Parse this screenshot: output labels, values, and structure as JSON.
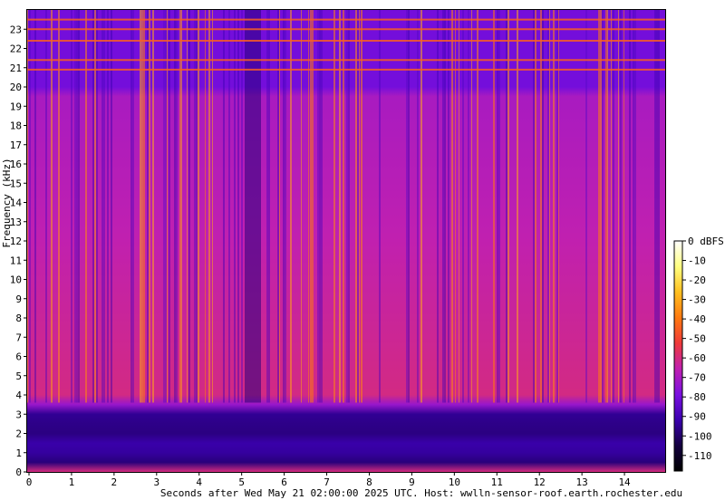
{
  "chart_data": {
    "type": "heatmap",
    "title": "",
    "xlabel": "Seconds after Wed May 21 02:00:00 2025 UTC. Host: wwlln-sensor-roof.earth.rochester.edu",
    "ylabel": "Frequency (kHz)",
    "xlim": [
      0,
      15
    ],
    "ylim": [
      0,
      24
    ],
    "x_ticks": [
      "0",
      "1",
      "2",
      "3",
      "4",
      "5",
      "6",
      "7",
      "8",
      "9",
      "10",
      "11",
      "12",
      "13",
      "14"
    ],
    "y_ticks": [
      "0",
      "1",
      "2",
      "3",
      "4",
      "5",
      "6",
      "7",
      "8",
      "9",
      "10",
      "11",
      "12",
      "13",
      "14",
      "15",
      "16",
      "17",
      "18",
      "19",
      "20",
      "21",
      "22",
      "23"
    ],
    "colorbar": {
      "unit_label": "dBFS",
      "ticks": [
        "0 dBFS",
        "-10",
        "-20",
        "-30",
        "-40",
        "-50",
        "-60",
        "-70",
        "-80",
        "-90",
        "-100",
        "-110"
      ],
      "range": [
        -118,
        0
      ],
      "stops": [
        "#000000",
        "#140040",
        "#3b00b0",
        "#7a10e0",
        "#c020b0",
        "#f03a3a",
        "#ff7a10",
        "#ffc020",
        "#ffff80",
        "#ffffff"
      ]
    },
    "features": {
      "low_band_khz": [
        0.2,
        3.0
      ],
      "low_band_level_dbfs": -95,
      "broadband_level_dbfs": -60,
      "quiet_band_khz": [
        20.0,
        24.0
      ],
      "quiet_band_level_dbfs": -80,
      "horizontal_lines_khz": [
        20.9,
        21.4,
        22.4,
        23.0,
        23.5
      ],
      "quiet_interval_s": [
        5.05,
        5.45
      ]
    },
    "grid": false,
    "legend": "colorbar-right"
  }
}
